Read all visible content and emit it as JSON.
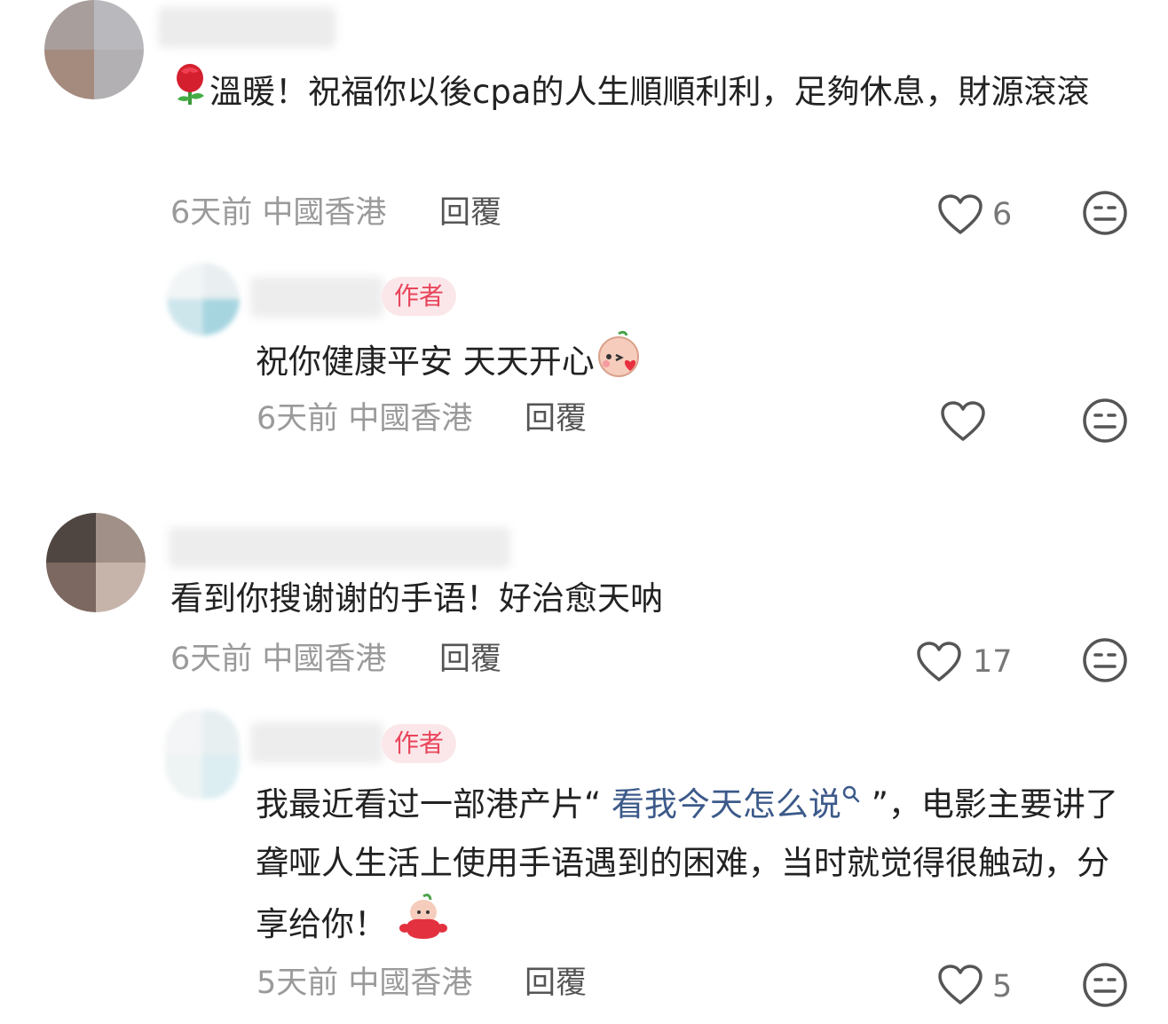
{
  "comments": [
    {
      "text": "溫暖！祝福你以後cpa的人生順順利利，足夠休息，財源滾滾",
      "emoji": "rose-emoji",
      "meta": "6天前 中國香港",
      "reply_label": "回覆",
      "likes": "6"
    },
    {
      "author_tag": "作者",
      "text": "祝你健康平安 天天开心",
      "emoji": "blowing-kiss-emoji",
      "meta": "6天前 中國香港",
      "reply_label": "回覆",
      "likes": ""
    },
    {
      "text": "看到你搜谢谢的手语！好治愈天呐",
      "meta": "6天前 中國香港",
      "reply_label": "回覆",
      "likes": "17"
    },
    {
      "author_tag": "作者",
      "text_before": "我最近看过一部港产片“ ",
      "link_text": "看我今天怎么说",
      "text_after": " ”，电影主要讲了聋哑人生活上使用手语遇到的困难，当时就觉得很触动，分享给你！",
      "emoji": "mascot-emoji",
      "meta": "5天前 中國香港",
      "reply_label": "回覆",
      "likes": "5"
    }
  ],
  "colors": {
    "author_tag_bg": "#fbe7ea",
    "author_tag_text": "#e8445a",
    "link": "#3c5a8a",
    "meta": "#9a9a9a"
  }
}
